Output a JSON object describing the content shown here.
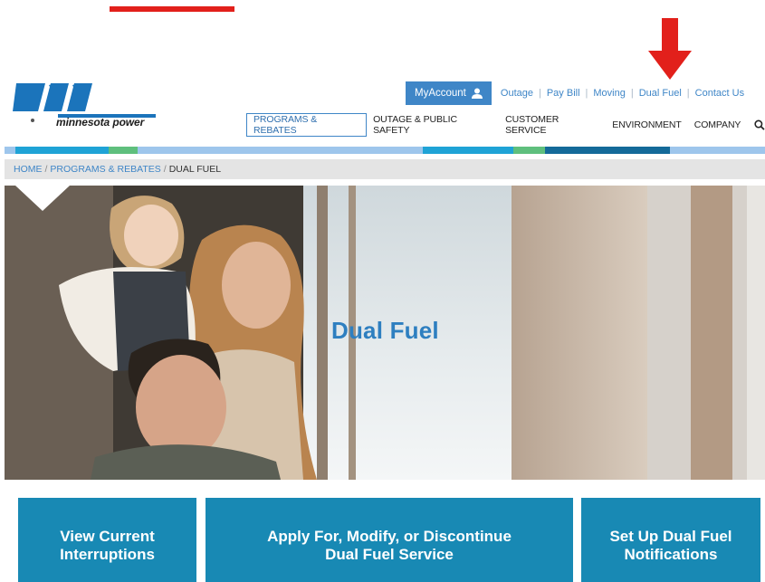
{
  "brand": {
    "name": "minnesota power"
  },
  "utility_nav": {
    "myaccount_label": "MyAccount",
    "links": [
      "Outage",
      "Pay Bill",
      "Moving",
      "Dual Fuel",
      "Contact Us"
    ]
  },
  "main_nav": {
    "items": [
      "PROGRAMS & REBATES",
      "OUTAGE & PUBLIC SAFETY",
      "CUSTOMER SERVICE",
      "ENVIRONMENT",
      "COMPANY"
    ]
  },
  "breadcrumb": {
    "items": [
      "HOME",
      "PROGRAMS & REBATES"
    ],
    "current": "DUAL FUEL",
    "separator": "/"
  },
  "hero": {
    "title": "Dual Fuel"
  },
  "actions": [
    {
      "line1": "View Current",
      "line2": "Interruptions"
    },
    {
      "line1": "Apply For, Modify, or Discontinue",
      "line2": "Dual Fuel Service"
    },
    {
      "line1": "Set Up Dual Fuel",
      "line2": "Notifications"
    }
  ],
  "colors": {
    "accent_blue": "#3f86c7",
    "cta_teal": "#1889b4",
    "annotation_red": "#e2201b",
    "stripe": [
      "#9ec6ec",
      "#1fa3d6",
      "#5fbf7d",
      "#9ec6ec",
      "#1fa3d6",
      "#5fbf7d",
      "#146a99",
      "#9ec6ec"
    ]
  },
  "icons": {
    "user": "user-icon",
    "search": "search-icon",
    "arrow": "down-arrow-icon"
  }
}
